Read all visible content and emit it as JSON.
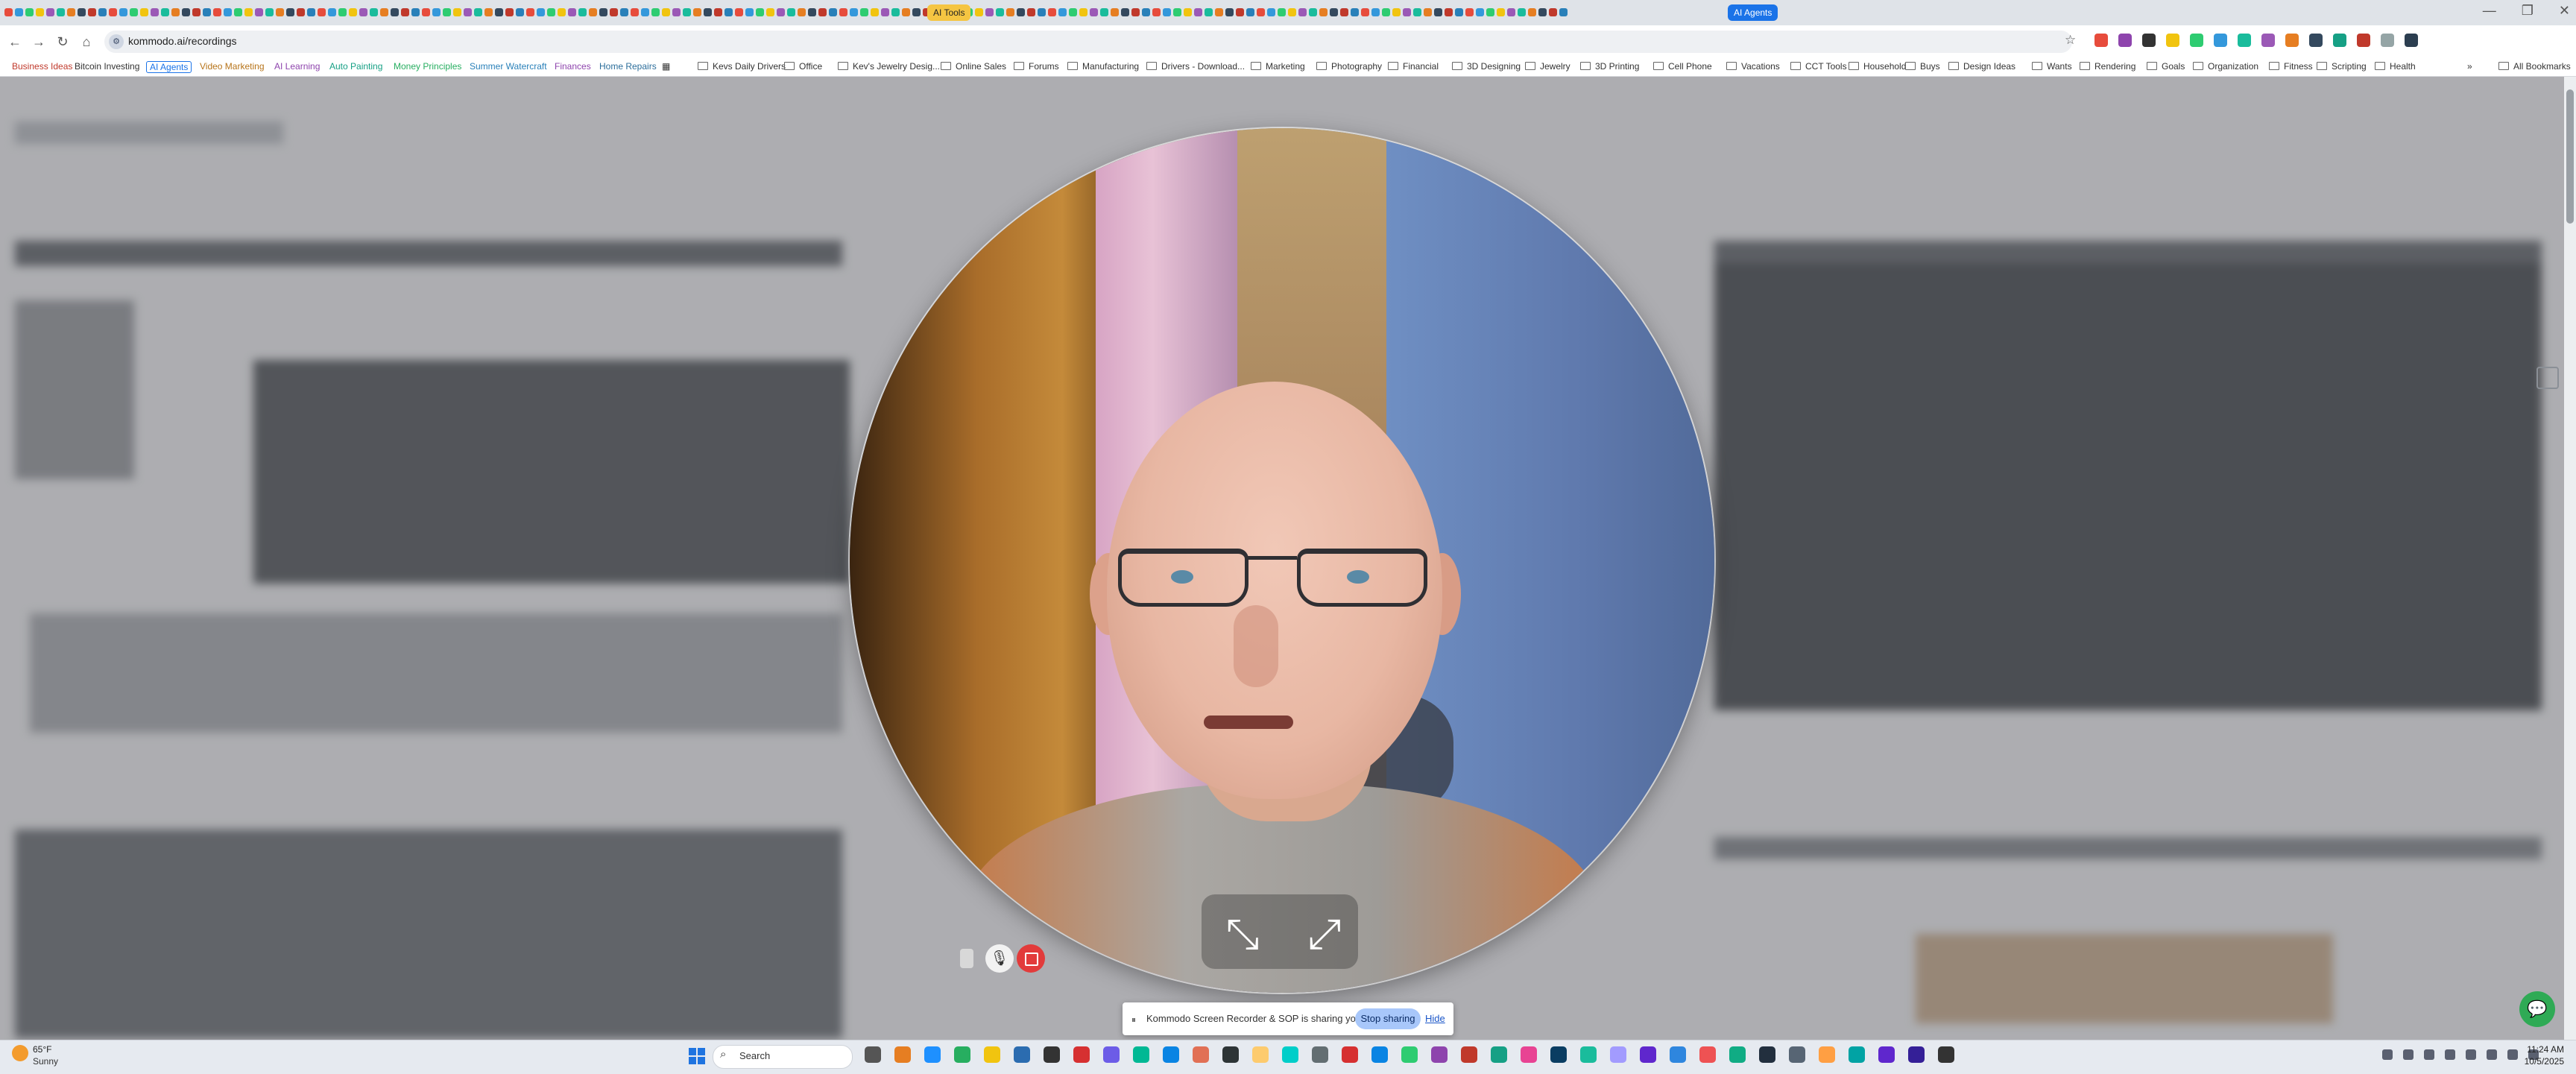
{
  "browser": {
    "tab_chip_left": "AI Tools",
    "tab_chip_right": "AI Agents",
    "url": "kommodo.ai/recordings",
    "window_controls": [
      "—",
      "❐",
      "✕"
    ]
  },
  "bookmarks": {
    "tagged": [
      {
        "label": "Business Ideas",
        "color": "#c0392b"
      },
      {
        "label": "Bitcoin Investing",
        "color": "#2c3e50"
      },
      {
        "label": "AI Agents",
        "color": "#1a73e8"
      },
      {
        "label": "Video Marketing",
        "color": "#b7741a"
      },
      {
        "label": "AI Learning",
        "color": "#8e44ad"
      },
      {
        "label": "Auto Painting",
        "color": "#16a085"
      },
      {
        "label": "Money Principles",
        "color": "#27ae60"
      },
      {
        "label": "Summer Watercraft",
        "color": "#2980b9"
      },
      {
        "label": "Finances",
        "color": "#8e44ad"
      },
      {
        "label": "Home Repairs",
        "color": "#2c6e9b"
      }
    ],
    "folders": [
      "Kevs Daily Drivers",
      "Office",
      "Kev's Jewelry Desig...",
      "Online Sales",
      "Forums",
      "Manufacturing",
      "Drivers - Download...",
      "Marketing",
      "Photography",
      "Financial",
      "3D Designing",
      "Jewelry",
      "3D Printing",
      "Cell Phone",
      "Vacations",
      "CCT Tools",
      "Household",
      "Buys",
      "Design Ideas",
      "Wants",
      "Rendering",
      "Goals",
      "Organization",
      "Fitness",
      "Scripting",
      "Health"
    ],
    "all_bookmarks": "All Bookmarks"
  },
  "recorder": {
    "share_message": "Kommodo Screen Recorder & SOP is sharing your screen.",
    "stop_sharing": "Stop sharing",
    "hide": "Hide"
  },
  "taskbar": {
    "weather_temp": "65°F",
    "weather_condition": "Sunny",
    "search_label": "Search",
    "time": "11:24 AM",
    "date": "10/5/2025"
  },
  "colors": {
    "accent": "#1a73e8",
    "stop_button": "#e23b3b",
    "chat_button": "#2faa55"
  }
}
